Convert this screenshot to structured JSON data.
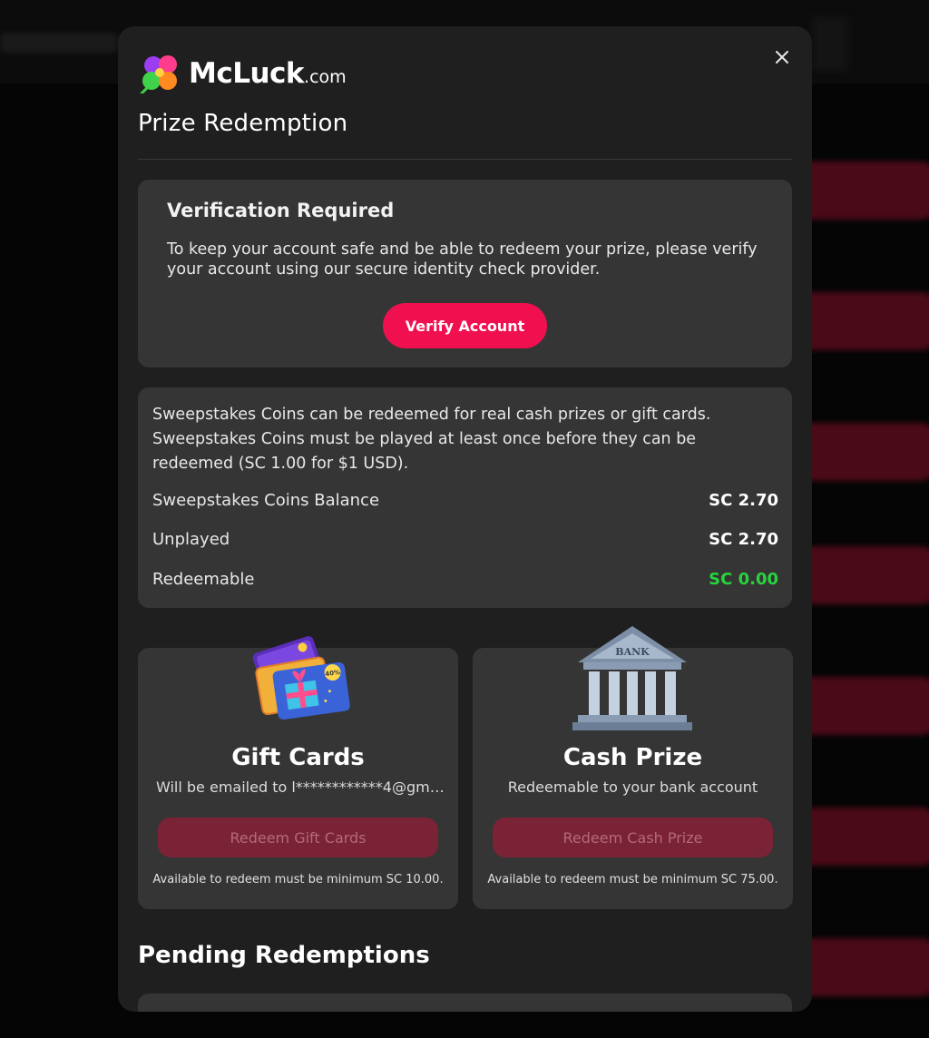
{
  "brand": {
    "name": "McLuck",
    "suffix": ".com",
    "accent_color": "#f0104f"
  },
  "modal": {
    "title": "Prize Redemption",
    "close_icon": "close-icon"
  },
  "verification": {
    "title": "Verification Required",
    "text": "To keep your account safe and be able to redeem your prize, please verify your account using our secure identity check provider.",
    "button_label": "Verify Account"
  },
  "info": {
    "text": "Sweepstakes Coins can be redeemed for real cash prizes or gift cards. Sweepstakes Coins must be played at least once before they can be redeemed (SC 1.00 for $1 USD).",
    "rows": [
      {
        "label": "Sweepstakes Coins Balance",
        "value": "SC 2.70"
      },
      {
        "label": "Unplayed",
        "value": "SC 2.70"
      },
      {
        "label": "Redeemable",
        "value": "SC 0.00",
        "color": "#27d43c"
      }
    ]
  },
  "options": {
    "gift": {
      "icon": "gift-cards-icon",
      "title": "Gift Cards",
      "subtitle": "Will be emailed to  l************4@gm…",
      "button_label": "Redeem Gift Cards",
      "note": "Available to redeem must be minimum SC 10.00."
    },
    "cash": {
      "icon": "bank-icon",
      "bank_label": "BANK",
      "title": "Cash Prize",
      "subtitle": "Redeemable to your bank account",
      "button_label": "Redeem Cash Prize",
      "note": "Available to redeem must be minimum SC 75.00."
    }
  },
  "pending": {
    "title": "Pending Redemptions"
  }
}
